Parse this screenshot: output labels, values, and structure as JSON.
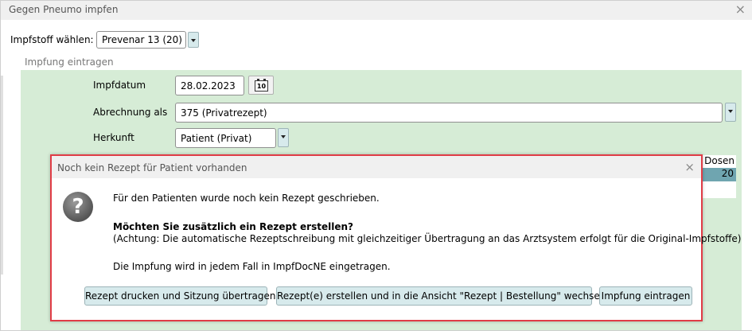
{
  "window": {
    "title": "Gegen Pneumo impfen",
    "close": "×"
  },
  "vaccine": {
    "label": "Impfstoff wählen:",
    "value": "Prevenar 13 (20)"
  },
  "group": {
    "title": "Impfung eintragen"
  },
  "form": {
    "date_label": "Impfdatum",
    "date_value": "28.02.2023",
    "calendar_day": "10",
    "billing_label": "Abrechnung als",
    "billing_value": "375 (Privatrezept)",
    "origin_label": "Herkunft",
    "origin_value": "Patient (Privat)"
  },
  "table": {
    "header": "Dosen",
    "cell": "20"
  },
  "dialog": {
    "title": "Noch kein Rezept für Patient vorhanden",
    "close": "×",
    "icon": "?",
    "line1": "Für den Patienten wurde noch kein Rezept geschrieben.",
    "question": "Möchten Sie zusätzlich ein Rezept erstellen?",
    "note": "(Achtung: Die automatische Rezeptschreibung mit gleichzeitiger Übertragung an das Arztsystem erfolgt für die Original-Impfstoffe)",
    "info": "Die Impfung wird in jedem Fall in ImpfDocNE eingetragen.",
    "btn_print": "Rezept drucken und Sitzung übertragen",
    "btn_create": "Rezept(e) erstellen und in die Ansicht \"Rezept | Bestellung\" wechseln",
    "btn_enter": "Impfung eintragen"
  }
}
